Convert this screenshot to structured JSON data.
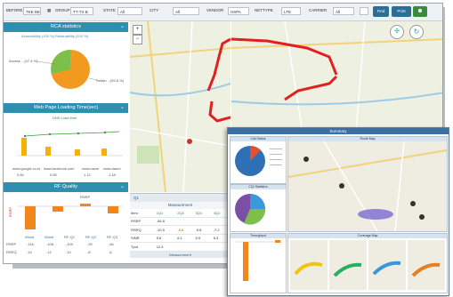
{
  "toolbar": {
    "filters": [
      {
        "label": "BEFORE",
        "value": "TKE BE"
      },
      {
        "label": "GROUP",
        "value": "TT-TX B"
      },
      {
        "label": "STATE",
        "value": "All"
      },
      {
        "label": "CITY",
        "value": "All"
      },
      {
        "label": "VENDOR",
        "value": "HSPA"
      },
      {
        "label": "NETTYPE",
        "value": "LTE"
      },
      {
        "label": "CARRIER",
        "value": "All"
      }
    ],
    "find_label": "Find",
    "print_label": "Print",
    "mail_label": "Mail"
  },
  "rca": {
    "title": "RCA statistics",
    "legend": "Accessibility (100 %)   Retainability (100 %)",
    "pie_label_left": "Access ...(47.4 %)",
    "pie_label_right": "Retain ...(52.6 %)"
  },
  "web": {
    "title": "Web Page Loading Time(sec)",
    "legend": "DNS   Load time",
    "cols": [
      "www.google.co.kr",
      "www.facebook.com",
      "www.naver",
      "www.daum"
    ],
    "vals": [
      "0.84",
      "0.85",
      "1.12",
      "1.18"
    ]
  },
  "rf": {
    "title": "RF Quality",
    "bar_label": "RSRP",
    "row_label_1": "RSRP",
    "row_label_2": "RSRQ",
    "cols": [
      "Worst",
      "Worst",
      "RF-Q1",
      "RF-Q2",
      "RF-Q3"
    ],
    "row1": [
      "-116",
      "-108",
      "-100",
      "-92",
      "-84"
    ],
    "row2": [
      "-14",
      "-12",
      "-10",
      "-8",
      "-6"
    ]
  },
  "table": {
    "tab_label": "Q1",
    "header": "Measurement",
    "cols": [
      "Item",
      "1Q1",
      "2Q1",
      "3Q1",
      "4Q1"
    ],
    "rows": [
      [
        "RSRP",
        "-96.8",
        "",
        "",
        ""
      ],
      [
        "RSRQ",
        "-10.5",
        "-8.6",
        "-9.8",
        "-7.2"
      ],
      [
        "SINR",
        "5.6",
        "6.1",
        "5.9",
        "6.3"
      ],
      [
        "Tput",
        "12.4",
        "",
        "",
        ""
      ]
    ],
    "footer": "Measurement"
  },
  "report": {
    "title": "Summary",
    "panel_a": "Call Status",
    "panel_b": "Route Map",
    "panel_c": "CQI Statistics",
    "panel_d": "Throughput",
    "panel_e": "Coverage Map"
  }
}
